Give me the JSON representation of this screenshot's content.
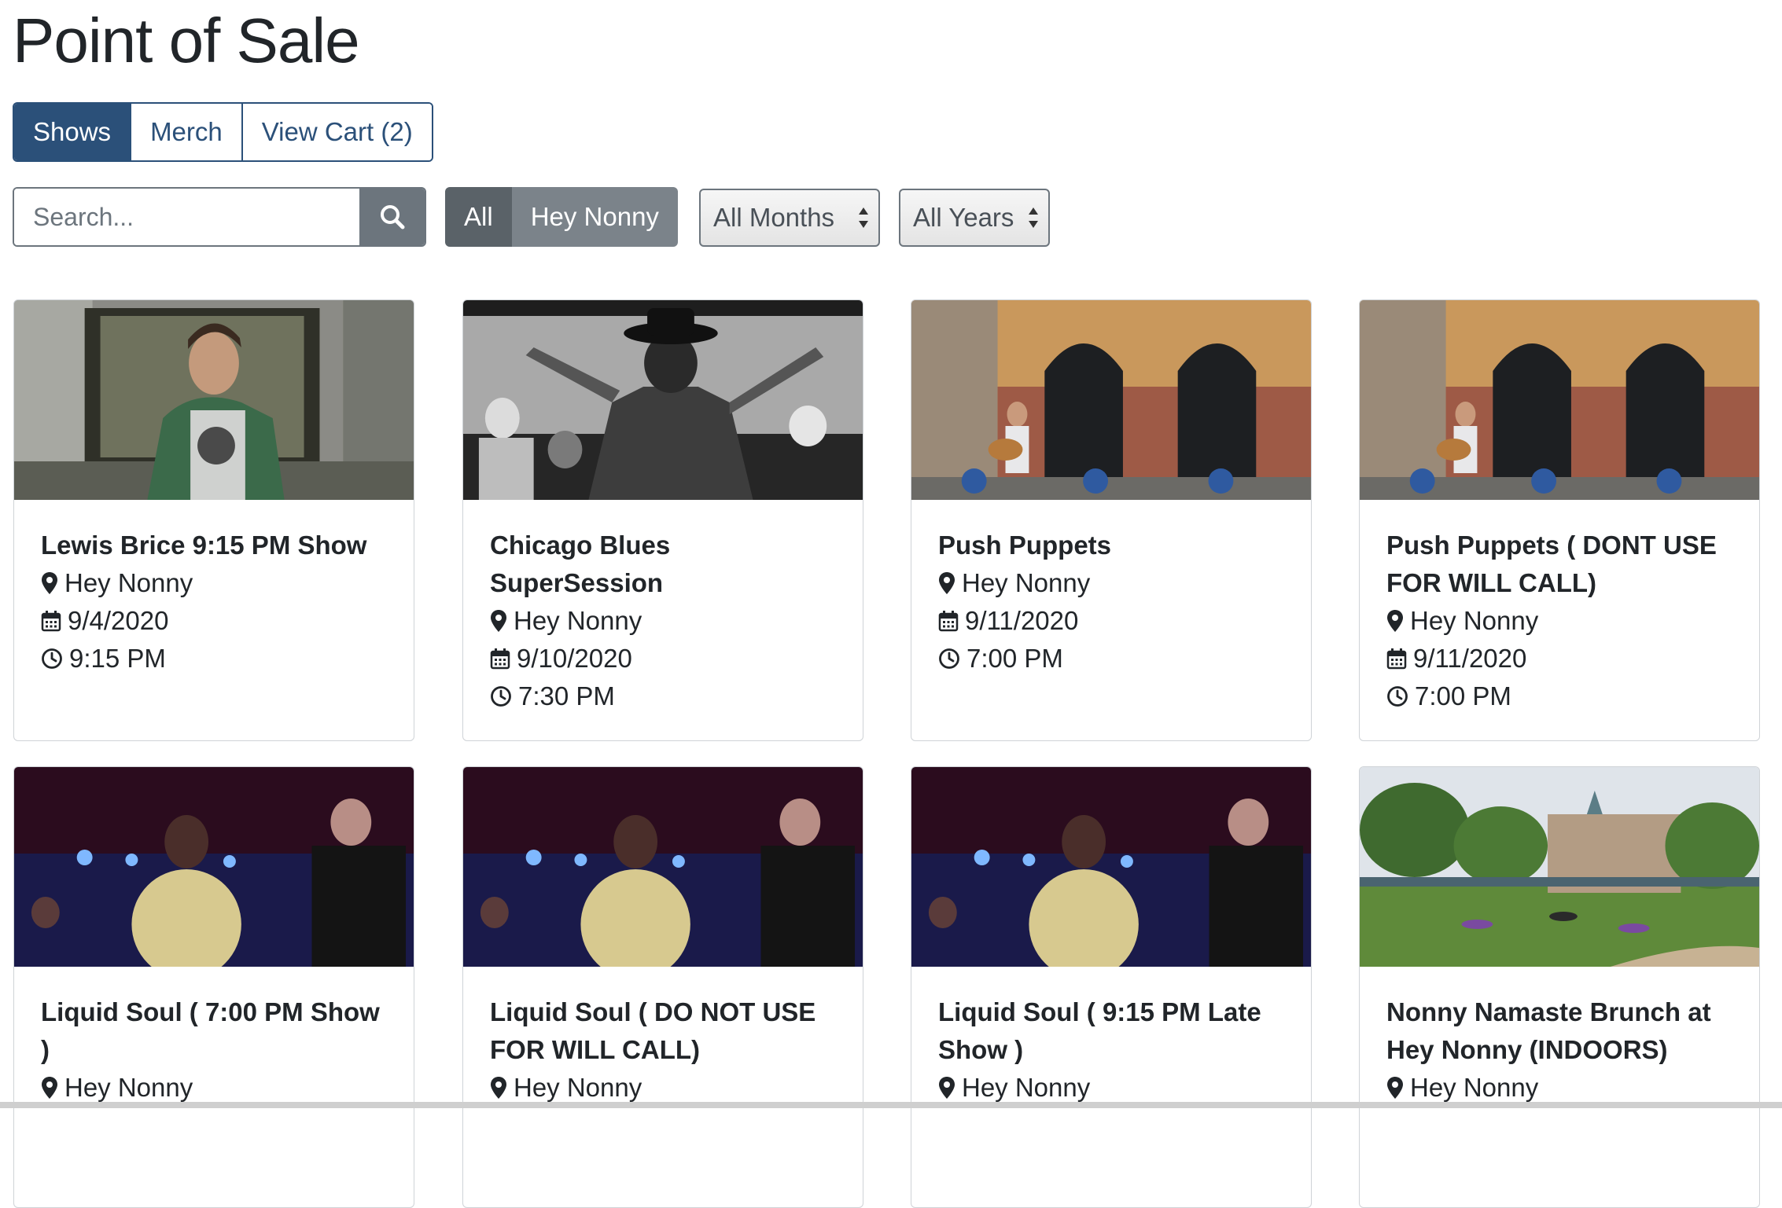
{
  "page": {
    "title": "Point of Sale"
  },
  "tabs": [
    {
      "label": "Shows",
      "active": true
    },
    {
      "label": "Merch",
      "active": false
    },
    {
      "label": "View Cart (2)",
      "active": false
    }
  ],
  "search": {
    "placeholder": "Search..."
  },
  "venue_filter": [
    {
      "label": "All",
      "active": true
    },
    {
      "label": "Hey Nonny",
      "active": false
    }
  ],
  "filters": {
    "month": "All Months",
    "year": "All Years"
  },
  "icons": {
    "search": "search-icon",
    "location": "map-pin-icon",
    "date": "calendar-icon",
    "time": "clock-icon"
  },
  "colors": {
    "primary": "#2b5079",
    "secondary": "#6c757d"
  },
  "cards": [
    {
      "title": "Lewis Brice 9:15 PM Show",
      "venue": "Hey Nonny",
      "date": "9/4/2020",
      "time": "9:15 PM"
    },
    {
      "title": "Chicago Blues SuperSession",
      "venue": "Hey Nonny",
      "date": "9/10/2020",
      "time": "7:30 PM"
    },
    {
      "title": "Push Puppets",
      "venue": "Hey Nonny",
      "date": "9/11/2020",
      "time": "7:00 PM"
    },
    {
      "title": "Push Puppets ( DONT USE FOR WILL CALL)",
      "venue": "Hey Nonny",
      "date": "9/11/2020",
      "time": "7:00 PM"
    },
    {
      "title": "Liquid Soul ( 7:00 PM Show )",
      "venue": "Hey Nonny"
    },
    {
      "title": "Liquid Soul ( DO NOT USE FOR WILL CALL)",
      "venue": "Hey Nonny"
    },
    {
      "title": "Liquid Soul ( 9:15 PM Late Show )",
      "venue": "Hey Nonny"
    },
    {
      "title": "Nonny Namaste Brunch at Hey Nonny (INDOORS)",
      "venue": "Hey Nonny"
    }
  ]
}
